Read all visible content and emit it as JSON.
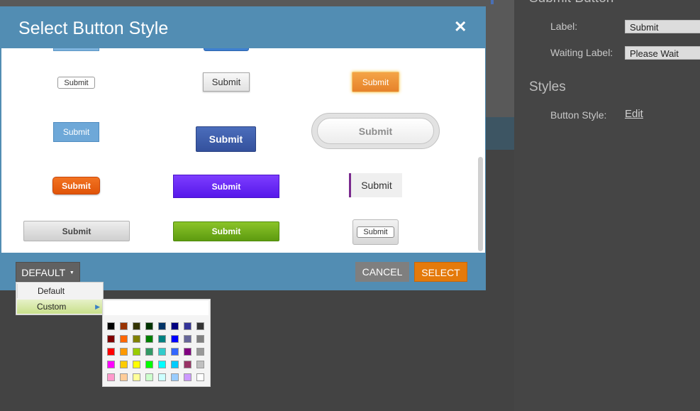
{
  "right_panel": {
    "section_heading": "Submit Button",
    "label_text": "Label:",
    "label_value": "Submit",
    "waiting_label_text": "Waiting Label:",
    "waiting_label_value": "Please Wait",
    "styles_heading": "Styles",
    "button_style_text": "Button Style:",
    "edit_link": "Edit"
  },
  "modal": {
    "title": "Select Button Style",
    "close_icon": "✕",
    "button_label": "Submit",
    "default_dropdown": "DEFAULT",
    "cancel": "CANCEL",
    "select": "SELECT"
  },
  "theme_menu": {
    "items": [
      "Default",
      "Custom"
    ]
  },
  "colors": {
    "header_blue": "#528db3",
    "select_orange": "#e47a0b",
    "cancel_gray": "#7f7f7f",
    "palette": [
      [
        "#000000",
        "#993300",
        "#333300",
        "#003300",
        "#003366",
        "#000080",
        "#333399",
        "#333333"
      ],
      [
        "#800000",
        "#ff6600",
        "#808000",
        "#008000",
        "#008080",
        "#0000ff",
        "#666699",
        "#808080"
      ],
      [
        "#ff0000",
        "#ff9900",
        "#99cc00",
        "#339966",
        "#33cccc",
        "#3366ff",
        "#800080",
        "#999999"
      ],
      [
        "#ff00ff",
        "#ffcc00",
        "#ffff00",
        "#00ff00",
        "#00ffff",
        "#00ccff",
        "#993366",
        "#c0c0c0"
      ],
      [
        "#ff99cc",
        "#ffcc99",
        "#ffff99",
        "#ccffcc",
        "#ccffff",
        "#99ccff",
        "#cc99ff",
        "#ffffff"
      ]
    ]
  }
}
